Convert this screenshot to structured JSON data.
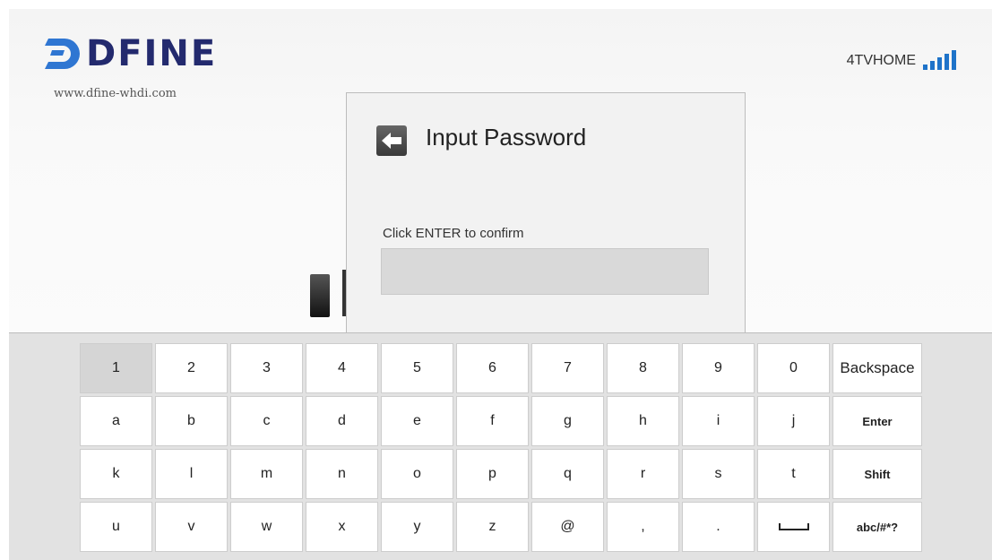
{
  "brand": {
    "name": "DFINE",
    "url": "www.dfine-whdi.com",
    "color": "#232a6e"
  },
  "network": {
    "name": "4TVHOME",
    "signal_bars": 5,
    "signal_color": "#1e73c9"
  },
  "dialog": {
    "title": "Input Password",
    "hint": "Click ENTER to confirm",
    "password_value": ""
  },
  "keyboard": {
    "rows": [
      [
        "1",
        "2",
        "3",
        "4",
        "5",
        "6",
        "7",
        "8",
        "9",
        "0",
        "Backspace"
      ],
      [
        "a",
        "b",
        "c",
        "d",
        "e",
        "f",
        "g",
        "h",
        "i",
        "j",
        "Enter"
      ],
      [
        "k",
        "l",
        "m",
        "n",
        "o",
        "p",
        "q",
        "r",
        "s",
        "t",
        "Shift"
      ],
      [
        "u",
        "v",
        "w",
        "x",
        "y",
        "z",
        "@",
        ",",
        ".",
        "",
        "abc/#*?"
      ]
    ],
    "selected_key": "1"
  }
}
